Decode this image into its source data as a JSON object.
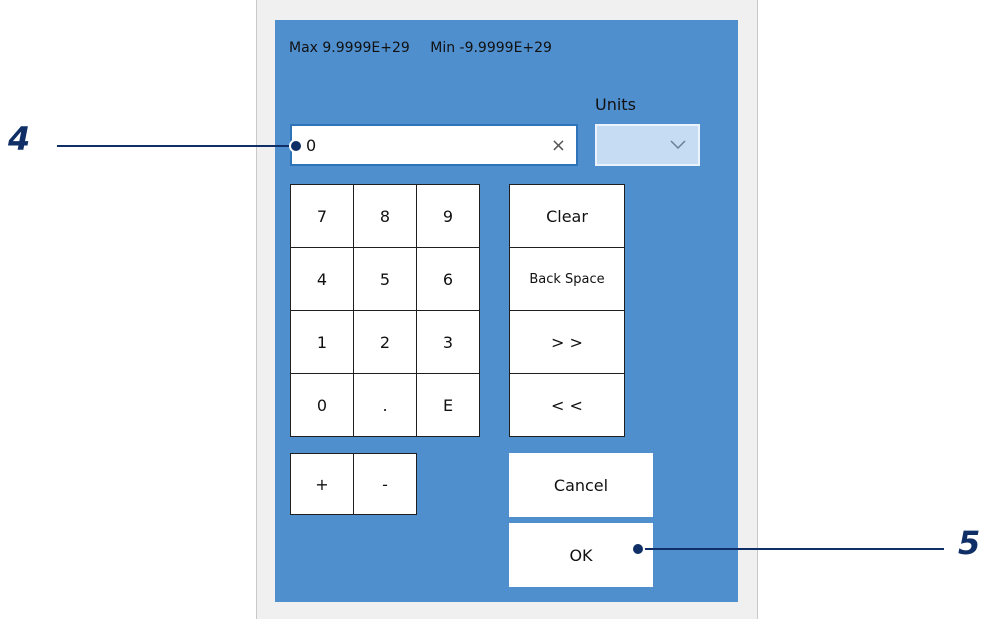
{
  "range": {
    "max": "Max 9.9999E+29",
    "min": "Min -9.9999E+29"
  },
  "units": {
    "label": "Units",
    "selected": ""
  },
  "input": {
    "value": "0",
    "clear_glyph": "×"
  },
  "keypad": {
    "row1": [
      "7",
      "8",
      "9"
    ],
    "row2": [
      "4",
      "5",
      "6"
    ],
    "row3": [
      "1",
      "2",
      "3"
    ],
    "row4": [
      "0",
      ".",
      "E"
    ],
    "sign": [
      "+",
      "-"
    ]
  },
  "edit_buttons": {
    "clear": "Clear",
    "backspace": "Back Space",
    "forward": "> >",
    "back": "< <"
  },
  "actions": {
    "cancel": "Cancel",
    "ok": "OK"
  },
  "callouts": {
    "input_marker": "4",
    "ok_marker": "5"
  },
  "colors": {
    "panel": "#4f8fce",
    "accent": "#2f73b8",
    "callout": "#0f2f66"
  },
  "icons": {
    "dropdown": "chevron-down-icon",
    "clear_input": "close-icon"
  }
}
